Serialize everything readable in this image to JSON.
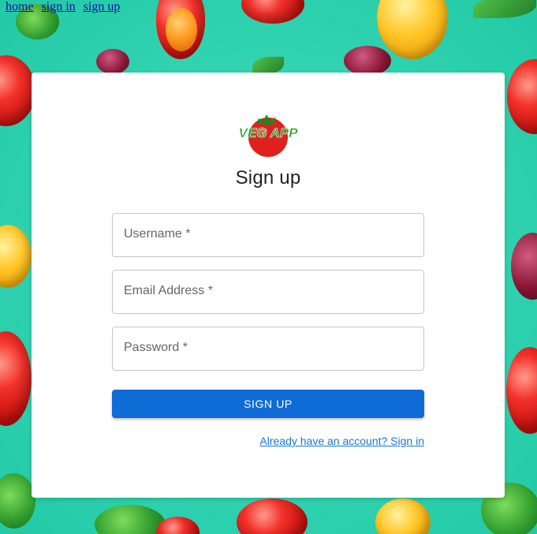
{
  "nav": {
    "links": [
      {
        "label": "home"
      },
      {
        "label": "sign in"
      },
      {
        "label": "sign up"
      }
    ]
  },
  "brand": {
    "logo_text": "VEG APP",
    "logo_icon": "tomato-icon",
    "text_color": "#16a01c",
    "tomato_color": "#e0201c"
  },
  "form": {
    "title": "Sign up",
    "fields": [
      {
        "label": "Username *",
        "value": ""
      },
      {
        "label": "Email Address *",
        "value": ""
      },
      {
        "label": "Password *",
        "value": ""
      }
    ],
    "submit_label": "SIGN UP",
    "signin_link": "Already have an account? Sign in"
  },
  "colors": {
    "background": "#2fd6b2",
    "button": "#0f6bd6",
    "link": "#1976d2"
  }
}
